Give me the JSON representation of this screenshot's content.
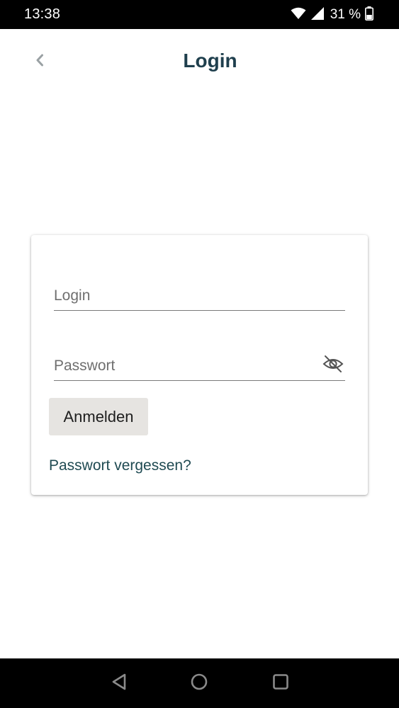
{
  "status_bar": {
    "time": "13:38",
    "battery": "31 %",
    "icons": [
      "wifi-icon",
      "signal-icon",
      "battery-icon"
    ]
  },
  "app_bar": {
    "title": "Login",
    "back_icon": "chevron-left-icon"
  },
  "login_form": {
    "login_field": {
      "value": "",
      "placeholder": "Login"
    },
    "password_field": {
      "value": "",
      "placeholder": "Passwort",
      "visibility_icon": "eye-off-icon"
    },
    "submit_label": "Anmelden",
    "forgot_password_label": "Passwort vergessen?"
  },
  "nav_bar": {
    "buttons": [
      "back-triangle-icon",
      "home-circle-icon",
      "recents-square-icon"
    ]
  },
  "colors": {
    "title": "#1f3f4d",
    "link": "#1f4a52",
    "button_bg": "#e6e4e1",
    "system_bars": "#000000"
  }
}
